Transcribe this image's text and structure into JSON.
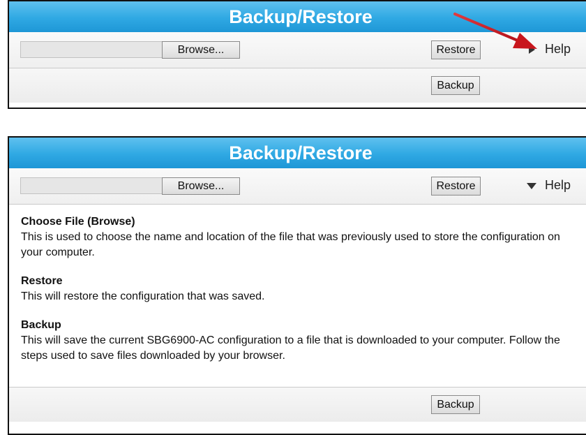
{
  "panels": {
    "collapsed": {
      "title": "Backup/Restore",
      "browse_label": "Browse...",
      "restore_label": "Restore",
      "help_label": "Help",
      "help_state": "collapsed",
      "backup_label": "Backup"
    },
    "expanded": {
      "title": "Backup/Restore",
      "browse_label": "Browse...",
      "restore_label": "Restore",
      "help_label": "Help",
      "help_state": "expanded",
      "backup_label": "Backup",
      "help": [
        {
          "heading": "Choose File (Browse)",
          "text": "This is used to choose the name and location of the file that was previously used to store the configuration on your computer."
        },
        {
          "heading": "Restore",
          "text": "This will restore the configuration that was saved."
        },
        {
          "heading": "Backup",
          "text": "This will save the current SBG6900-AC configuration to a file that is downloaded to your computer. Follow the steps used to save files downloaded by your browser."
        }
      ]
    }
  },
  "annotation": {
    "arrow_color": "#c8161d",
    "points_to": "Help"
  },
  "colors": {
    "title_bar": "#2fa8e3",
    "title_text": "#ffffff"
  }
}
